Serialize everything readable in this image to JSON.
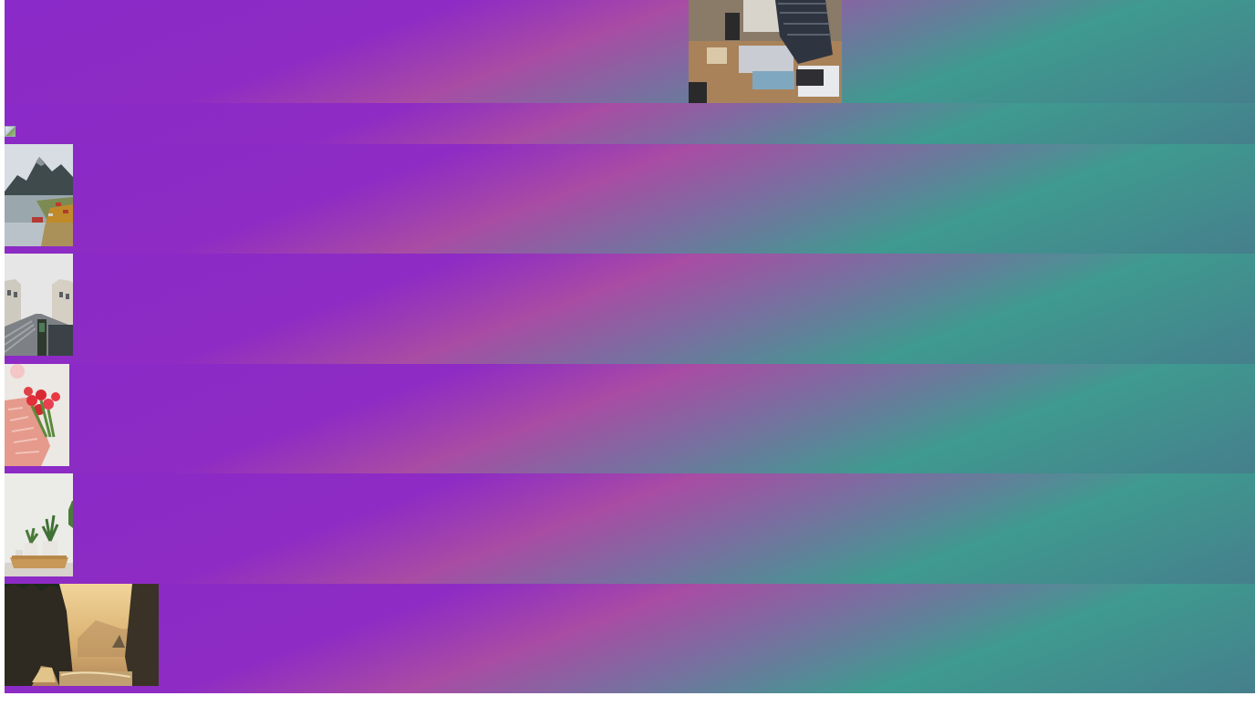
{
  "images": [
    {
      "name": "workspace-laptop-photo",
      "alt": ""
    },
    {
      "name": "broken-image",
      "alt": ""
    },
    {
      "name": "mountain-coast-village-photo",
      "alt": ""
    },
    {
      "name": "street-buildings-tram-photo",
      "alt": ""
    },
    {
      "name": "tulip-bouquet-photo",
      "alt": ""
    },
    {
      "name": "potted-plants-stool-photo",
      "alt": ""
    },
    {
      "name": "misty-sea-arch-sunset-photo",
      "alt": ""
    }
  ]
}
